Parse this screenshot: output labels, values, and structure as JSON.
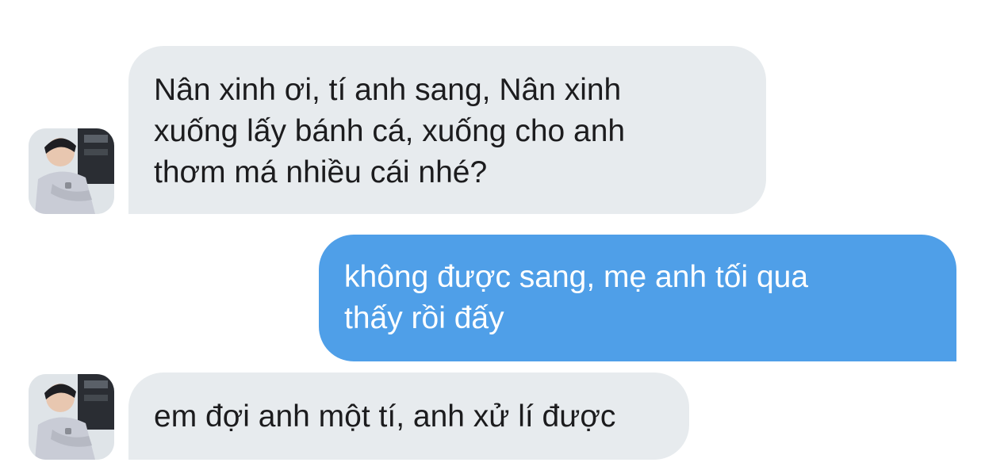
{
  "conversation": {
    "messages": [
      {
        "direction": "incoming",
        "text": "Nân xinh ơi, tí anh sang, Nân xinh\nxuống lấy bánh cá, xuống cho anh\nthơm má nhiều cái nhé?",
        "avatar": "contact-avatar-photo"
      },
      {
        "direction": "outgoing",
        "text": "không được sang, mẹ anh tối qua\nthấy rồi đấy"
      },
      {
        "direction": "incoming",
        "text": "em đợi anh một tí, anh xử lí được",
        "avatar": "contact-avatar-photo"
      }
    ]
  },
  "colors": {
    "incoming_bubble": "#e7ebee",
    "outgoing_bubble": "#4f9fe8",
    "incoming_text": "#1c1c1e",
    "outgoing_text": "#ffffff",
    "background": "#ffffff"
  }
}
